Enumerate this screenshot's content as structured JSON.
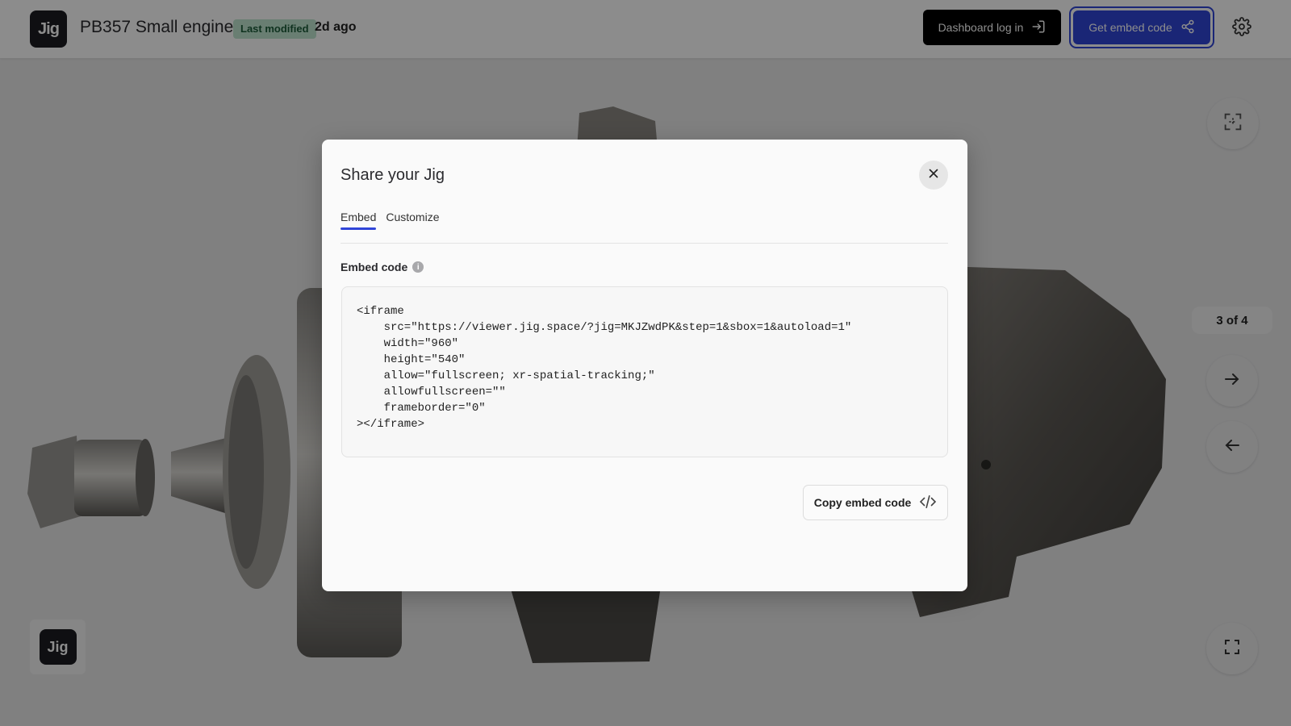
{
  "header": {
    "logo_text": "Jig",
    "title": "PB357 Small engine",
    "badge": "Last modified",
    "modified_time": "2d ago",
    "dashboard_button": "Dashboard log in",
    "embed_button": "Get embed code",
    "icons": {
      "dashboard": "sign-in-icon",
      "embed": "share-icon",
      "settings": "gear-icon"
    }
  },
  "controls": {
    "step_indicator": "3 of 4",
    "icons": [
      "recenter-icon",
      "arrow-right-icon",
      "arrow-left-icon",
      "fullscreen-icon"
    ]
  },
  "corner_logo": "Jig",
  "modal": {
    "title": "Share your Jig",
    "tabs": [
      {
        "label": "Embed",
        "active": true
      },
      {
        "label": "Customize",
        "active": false
      }
    ],
    "section_label": "Embed code",
    "code": "<iframe\n    src=\"https://viewer.jig.space/?jig=MKJZwdPK&step=1&sbox=1&autoload=1\"\n    width=\"960\"\n    height=\"540\"\n    allow=\"fullscreen; xr-spatial-tracking;\"\n    allowfullscreen=\"\"\n    frameborder=\"0\"\n></iframe>",
    "copy_button": "Copy embed code",
    "icons": {
      "close": "close-icon",
      "info": "info-icon",
      "copy": "code-icon"
    }
  },
  "colors": {
    "accent": "#3045d8",
    "badge_bg": "#bfe6cf",
    "badge_text": "#1c5b3a"
  }
}
